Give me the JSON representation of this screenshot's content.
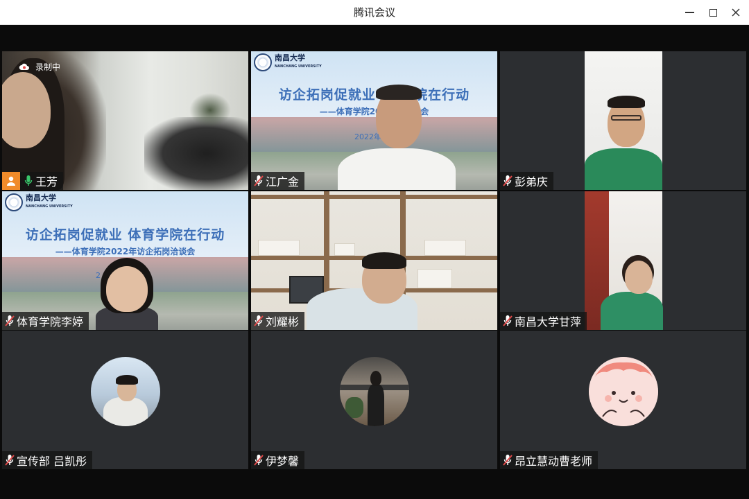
{
  "window": {
    "title": "腾讯会议",
    "controls": [
      "minimize-icon",
      "maximize-icon",
      "close-icon"
    ]
  },
  "recording": {
    "label": "录制中",
    "icon": "cloud-icon"
  },
  "participants": [
    {
      "name": "王芳",
      "mic": "on",
      "host": true,
      "video": "camera"
    },
    {
      "name": "江广金",
      "mic": "muted",
      "video": "camera"
    },
    {
      "name": "彭弟庆",
      "mic": "muted",
      "video": "camera"
    },
    {
      "name": "体育学院李婷",
      "mic": "muted",
      "video": "camera"
    },
    {
      "name": "刘耀彬",
      "mic": "muted",
      "video": "camera"
    },
    {
      "name": "南昌大学甘萍",
      "mic": "muted",
      "video": "camera"
    },
    {
      "name": "宣传部 吕凯彤",
      "mic": "muted",
      "video": "avatar"
    },
    {
      "name": "伊梦馨",
      "mic": "muted",
      "video": "avatar"
    },
    {
      "name": "昂立慧动曹老师",
      "mic": "muted",
      "video": "avatar"
    }
  ],
  "slide": {
    "university": "南昌大学",
    "university_en": "NANCHANG UNIVERSITY",
    "headline": "访企拓岗促就业  体育学院在行动",
    "subline": "——体育学院2022年访企拓岗洽谈会",
    "subline_partial": "——体育学院2022年        洽谈会",
    "headline_partial": "访企拓岗促就业  体    学院在行动",
    "date_partial": "2022年6月",
    "tile4_marker": "2"
  },
  "colors": {
    "active_speaker_border": "#3fb36b",
    "host_badge": "#f08b2a",
    "mic_on": "#39c46a",
    "mic_muted": "#e24a4a",
    "slide_text": "#3d6fb8"
  }
}
